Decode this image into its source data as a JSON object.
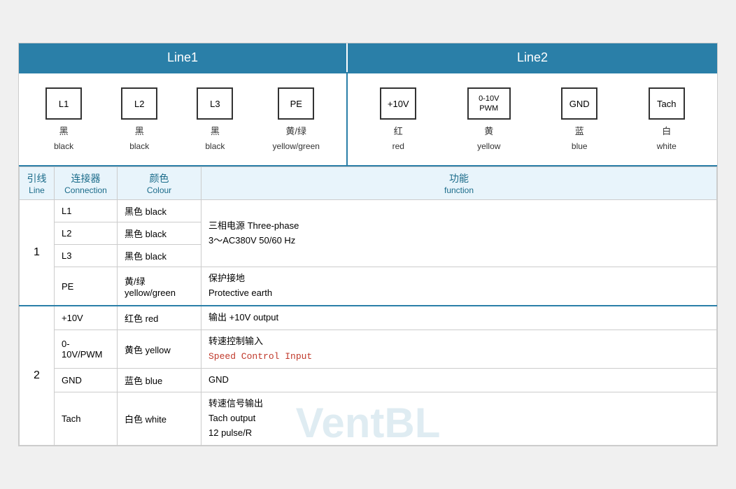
{
  "header": {
    "line1_label": "Line1",
    "line2_label": "Line2"
  },
  "diagram": {
    "line1": {
      "connectors": [
        {
          "id": "L1",
          "label_cn": "黑",
          "label_en": "black"
        },
        {
          "id": "L2",
          "label_cn": "黑",
          "label_en": "black"
        },
        {
          "id": "L3",
          "label_cn": "黑",
          "label_en": "black"
        },
        {
          "id": "PE",
          "label_cn": "黄/绿",
          "label_en": "yellow/green"
        }
      ]
    },
    "line2": {
      "connectors": [
        {
          "id": "+10V",
          "label_cn": "红",
          "label_en": "red"
        },
        {
          "id": "0-10V\nPWM",
          "label_cn": "黄",
          "label_en": "yellow"
        },
        {
          "id": "GND",
          "label_cn": "蓝",
          "label_en": "blue"
        },
        {
          "id": "Tach",
          "label_cn": "白",
          "label_en": "white"
        }
      ]
    }
  },
  "table": {
    "headers": {
      "line_cn": "引线",
      "line_en": "Line",
      "connection_cn": "连接器",
      "connection_en": "Connection",
      "colour_cn": "颜色",
      "colour_en": "Colour",
      "function_cn": "功能",
      "function_en": "function"
    },
    "rows": [
      {
        "group": "1",
        "rowspan": 4,
        "sub_rows": [
          {
            "connection": "L1",
            "colour": "黑色 black",
            "function": ""
          },
          {
            "connection": "L2",
            "colour": "黑色 black",
            "function_cn": "三相电源 Three-phase",
            "function_en": "3～AC380V 50/60 Hz"
          },
          {
            "connection": "L3",
            "colour": "黑色 black",
            "function": ""
          },
          {
            "connection": "PE",
            "colour": "黄/绿\nyellow/green",
            "function_cn": "保护接地",
            "function_en": "Protective earth"
          }
        ]
      },
      {
        "group": "2",
        "rowspan": 4,
        "sub_rows": [
          {
            "connection": "+10V",
            "colour": "红色 red",
            "function_cn": "输出 +10V output",
            "function_en": ""
          },
          {
            "connection": "0-10V/PWM",
            "colour": "黄色 yellow",
            "function_cn": "转速控制输入",
            "function_en": "Speed Control Input"
          },
          {
            "connection": "GND",
            "colour": "蓝色 blue",
            "function_cn": "GND",
            "function_en": ""
          },
          {
            "connection": "Tach",
            "colour": "白色 white",
            "function_cn": "转速信号输出",
            "function_en": "Tach output\n12 pulse/R"
          }
        ]
      }
    ]
  },
  "watermark": "VentBL"
}
